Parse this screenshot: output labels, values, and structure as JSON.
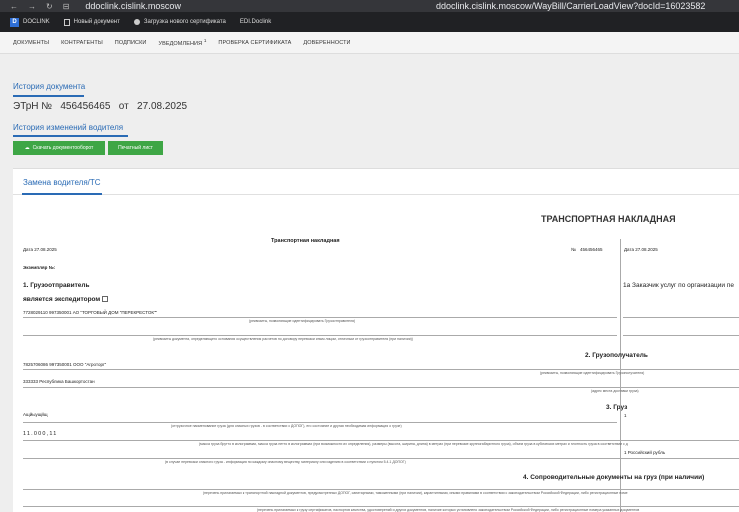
{
  "browser": {
    "url_short": "ddoclink.cislink.moscow",
    "url_full": "ddoclink.cislink.moscow/WayBill/CarrierLoadView?docId=16023582"
  },
  "bookmarks": [
    {
      "label": "DOCLINK"
    },
    {
      "label": "Новый документ"
    },
    {
      "label": "Загрузка нового сертификата"
    },
    {
      "label": "EDI.Doclink"
    }
  ],
  "nav": {
    "items": [
      "ДОКУМЕНТЫ",
      "КОНТРАГЕНТЫ",
      "ПОДПИСКИ",
      "УВЕДОМЛЕНИЯ",
      "ПРОВЕРКА СЕРТИФИКАТА",
      "ДОВЕРЕННОСТИ"
    ],
    "notifications_count": "1"
  },
  "history": {
    "title": "История документа",
    "doc_type": "ЭТрН №",
    "doc_number": "456456465",
    "doc_date_prefix": "от",
    "doc_date": "27.08.2025",
    "driver_history": "История изменений водителя"
  },
  "buttons": {
    "download": "Скачать документооборот",
    "print": "Печатный лист"
  },
  "panel": {
    "tab": "Замена водителя/ТС"
  },
  "document": {
    "big_title": "ТРАНСПОРТНАЯ НАКЛАДНАЯ",
    "subtitle": "Транспортная накладная",
    "date_label": "Дата  27.08.2025",
    "date_label_right": "Дата  27.08.2025",
    "number_label": "№",
    "number": "456456465",
    "copy_label": "Экземпляр №:",
    "s1_title": "1. Грузоотправитель",
    "forwarder": "является экспедитором",
    "shipper": "7728029110 997350001 АО \"ТОРГОВЫЙ ДОМ \"ПЕРЕКРЕСТОК\"\"",
    "cap_shipper": "(реквизиты, позволяющие идентифицировать Грузоотправителя)",
    "cap_contract": "(реквизиты документа, определяющего основания осуществления расчетов по договору перевозки иным лицом, отличным от грузоотправителя (при наличии))",
    "s1a_title": "1а Заказчик услуг по организации пе",
    "s2_title": "2. Грузополучатель",
    "consignee": "7825706086 997350001 ООО \"Агроторг\"",
    "cap_consignee": "(реквизиты, позволяющие идентифицировать Грузополучателя)",
    "address": "333333 Республика Башкортостан",
    "cap_address": "(адрес места доставки груза)",
    "s3_title": "3. Груз",
    "cargo_num": "1",
    "cargo_name": "Ащйыущйщ",
    "cap_cargo": "(отгрузочное наименование груза (для опасных грузов - в соответствии с ДОПОГ), его состояние и другая необходимая информация о грузе)",
    "weight": "11.000,11",
    "cap_weight": "(масса груза брутто в килограммах, масса груза нетто в килограммах (при возможности их определения), размеры (высота, ширина, длина) в метрах (при перевозке крупногабаритного груза), объем груза в кубических метрах и плотность груза в соответствии с д",
    "currency": "1 Российский рубль",
    "cap_danger": "(в случае перевозки опасного груза - информация по каждому опасному веществу, материалу или изделию в соответствии с пунктом 5.4.1 ДОПОГ)",
    "s4_title": "4. Сопроводительные документы на груз (при наличии)",
    "cap_docs": "(перечень прилагаемых к транспортной накладной документов, предусмотренных ДОПОГ, санитарными, таможенными (при наличии), карантинными, иными правилами в соответствии с законодательством Российской Федерации, либо регистрационные номе",
    "cap_docs2": "(перечень прилагаемых к грузу сертификатов, паспортов качества, удостоверений и других документов, наличие которых установлено законодательством Российской Федерации, либо регистрационные номера указанных документов"
  }
}
